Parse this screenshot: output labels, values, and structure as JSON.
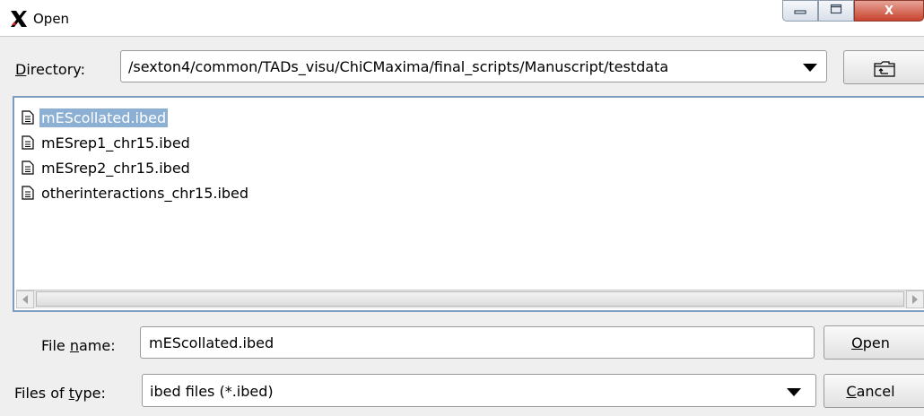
{
  "window": {
    "title": "Open",
    "icon": "x-app-icon",
    "controls": {
      "minimize": "minimize-icon",
      "maximize": "maximize-icon",
      "close_label": "X"
    }
  },
  "directory": {
    "label_mnemonic": "D",
    "label_rest": "irectory:",
    "path": "/sexton4/common/TADs_visu/ChiCMaxima/final_scripts/Manuscript/testdata",
    "up_icon": "parent-folder-icon"
  },
  "files": [
    {
      "name": "mEScollated.ibed",
      "selected": true
    },
    {
      "name": "mESrep1_chr15.ibed",
      "selected": false
    },
    {
      "name": "mESrep2_chr15.ibed",
      "selected": false
    },
    {
      "name": "otherinteractions_chr15.ibed",
      "selected": false
    }
  ],
  "file_name": {
    "label_pre": "File ",
    "label_mnemonic": "n",
    "label_post": "ame:",
    "value": "mEScollated.ibed"
  },
  "file_type": {
    "label_pre": "Files of ",
    "label_mnemonic": "t",
    "label_post": "ype:",
    "value": "ibed files (*.ibed)"
  },
  "buttons": {
    "open_mnemonic": "O",
    "open_rest": "pen",
    "cancel_mnemonic": "C",
    "cancel_rest": "ancel"
  },
  "colors": {
    "selection": "#8cb0d4",
    "list_border": "#7c9cc2",
    "close_button": "#c8432e"
  }
}
